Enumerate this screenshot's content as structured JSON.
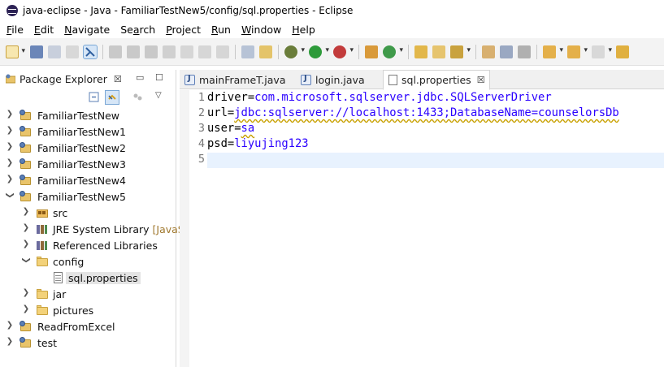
{
  "window": {
    "title": "java-eclipse - Java - FamiliarTestNew5/config/sql.properties - Eclipse"
  },
  "menu": [
    {
      "pre": "",
      "ul": "F",
      "post": "ile"
    },
    {
      "pre": "",
      "ul": "E",
      "post": "dit"
    },
    {
      "pre": "",
      "ul": "N",
      "post": "avigate"
    },
    {
      "pre": "Se",
      "ul": "a",
      "post": "rch"
    },
    {
      "pre": "",
      "ul": "P",
      "post": "roject"
    },
    {
      "pre": "",
      "ul": "R",
      "post": "un"
    },
    {
      "pre": "",
      "ul": "W",
      "post": "indow"
    },
    {
      "pre": "",
      "ul": "H",
      "post": "elp"
    }
  ],
  "package_explorer": {
    "tab_label": "Package Explorer",
    "close_glyph": "☒",
    "minimize_glyph": "▭",
    "maximize_glyph": "☐",
    "tree": [
      {
        "label": "FamiliarTestNew",
        "decor": ""
      },
      {
        "label": "FamiliarTestNew1",
        "decor": ""
      },
      {
        "label": "FamiliarTestNew2",
        "decor": ""
      },
      {
        "label": "FamiliarTestNew3",
        "decor": ""
      },
      {
        "label": "FamiliarTestNew4",
        "decor": ""
      },
      {
        "label": "FamiliarTestNew5",
        "decor": ""
      },
      {
        "label": "src",
        "decor": ""
      },
      {
        "label": "JRE System Library",
        "decor": "[JavaS"
      },
      {
        "label": "Referenced Libraries",
        "decor": ""
      },
      {
        "label": "config",
        "decor": ""
      },
      {
        "label": "sql.properties",
        "decor": ""
      },
      {
        "label": "jar",
        "decor": ""
      },
      {
        "label": "pictures",
        "decor": ""
      },
      {
        "label": "ReadFromExcel",
        "decor": ""
      },
      {
        "label": "test",
        "decor": ""
      }
    ]
  },
  "editor": {
    "tabs": [
      {
        "label": "mainFrameT.java"
      },
      {
        "label": "login.java"
      },
      {
        "label": "sql.properties"
      }
    ],
    "close_glyph": "☒",
    "line_numbers": [
      "1",
      "2",
      "3",
      "4",
      "5"
    ],
    "lines": [
      {
        "key": "driver=",
        "value": "com.microsoft.sqlserver.jdbc.SQLServerDriver"
      },
      {
        "key": "url=",
        "value": "jdbc:sqlserver://localhost:1433;DatabaseName=counselorsDb"
      },
      {
        "key": "user=",
        "value": "sa"
      },
      {
        "key": "psd=",
        "value": "liyujing123"
      },
      {
        "key": "",
        "value": ""
      }
    ]
  },
  "colors": {
    "property_value": "#2a00ff",
    "line_number": "#787878",
    "current_line": "#e8f2fe",
    "selection": "#e4e4e4"
  }
}
